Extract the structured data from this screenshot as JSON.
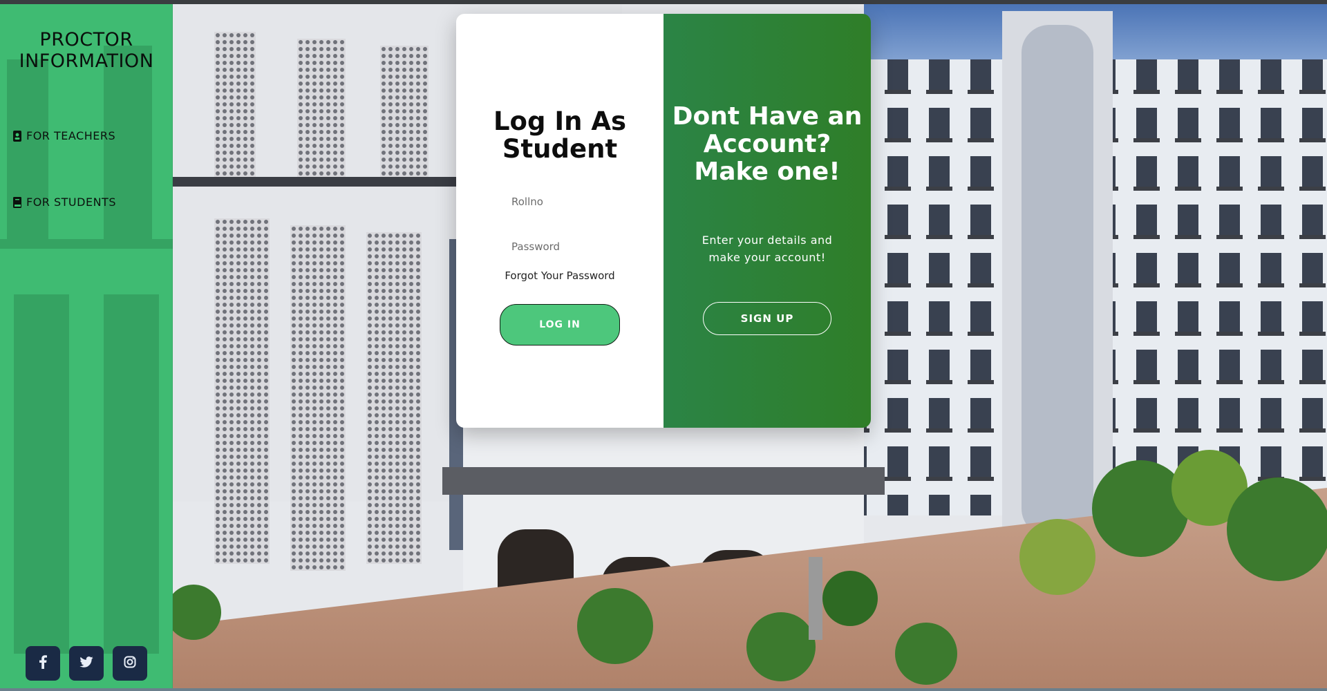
{
  "sidebar": {
    "brand": "PROCTOR INFORMATION",
    "items": [
      {
        "label": "FOR TEACHERS",
        "icon": "id-badge-icon"
      },
      {
        "label": "FOR STUDENTS",
        "icon": "book-icon"
      }
    ],
    "social": [
      {
        "icon": "facebook-icon"
      },
      {
        "icon": "twitter-icon"
      },
      {
        "icon": "instagram-icon"
      }
    ]
  },
  "login": {
    "title": "Log In As Student",
    "rollno_placeholder": "Rollno",
    "password_placeholder": "Password",
    "forgot_label": "Forgot Your Password",
    "login_button": "LOG IN"
  },
  "signup_panel": {
    "title": "Dont Have an Account? Make one!",
    "subtitle": "Enter your details and make your account!",
    "signup_button": "SIGN UP"
  },
  "colors": {
    "sidebar_green": "#39c46e",
    "panel_green": "#2f7e28",
    "login_button": "#4dc77c",
    "social_button": "#1a2a45"
  }
}
